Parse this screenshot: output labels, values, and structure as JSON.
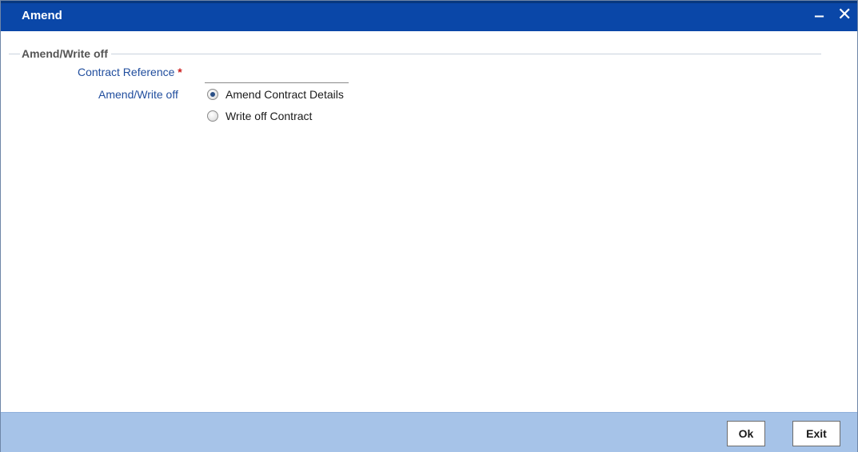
{
  "window": {
    "title": "Amend",
    "minimize_glyph": "‒",
    "close_glyph": "✕"
  },
  "form": {
    "legend": "Amend/Write off",
    "contract_reference": {
      "label": "Contract Reference",
      "required_marker": "*",
      "value": ""
    },
    "amend_write_off": {
      "label": "Amend/Write off",
      "options": [
        {
          "label": "Amend Contract Details",
          "selected": true
        },
        {
          "label": "Write off Contract",
          "selected": false
        }
      ]
    }
  },
  "footer": {
    "ok_label": "Ok",
    "exit_label": "Exit"
  },
  "colors": {
    "titlebar": "#0a47a8",
    "label_blue": "#214e9e",
    "footer": "#a6c3e8",
    "required": "#cc1a1a"
  }
}
